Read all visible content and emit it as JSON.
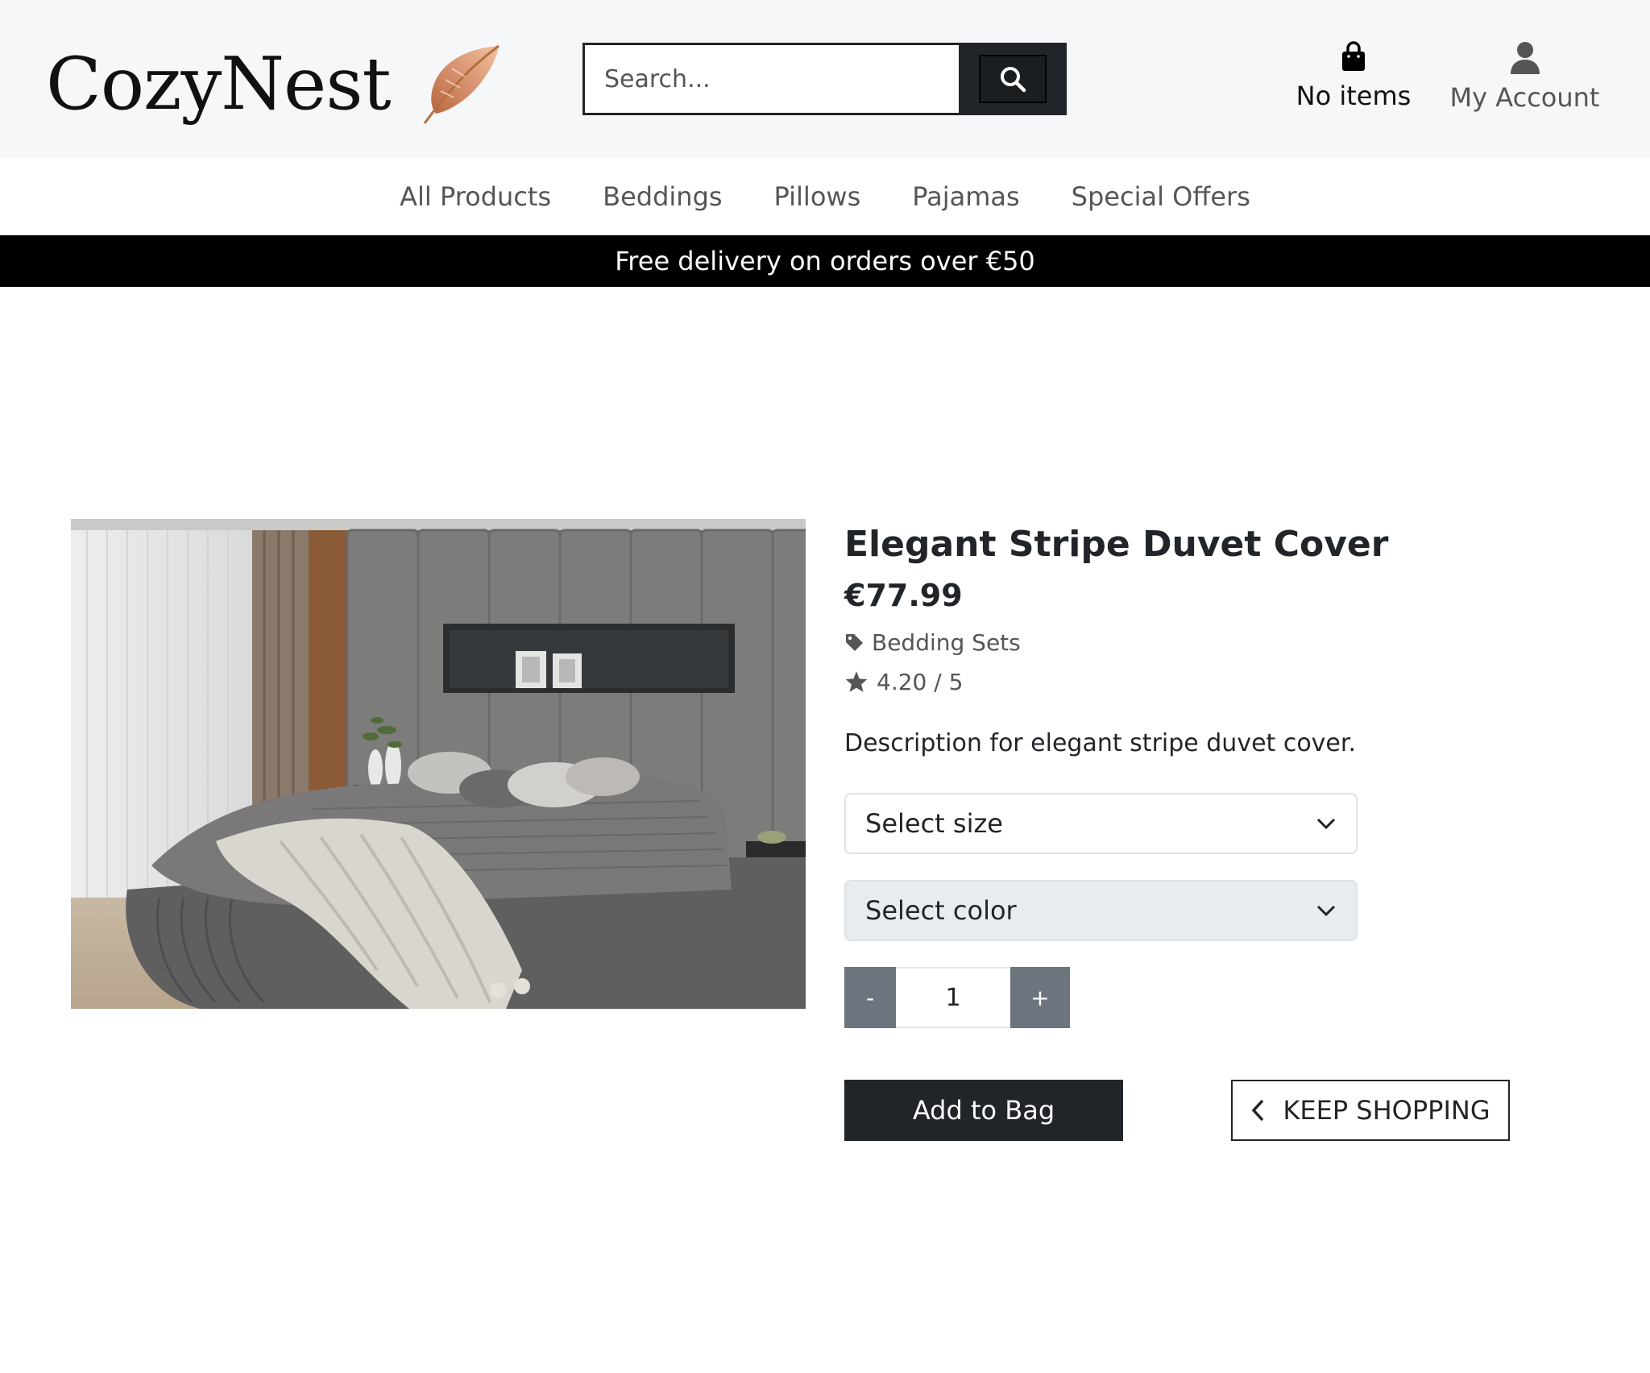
{
  "header": {
    "logo_text": "CozyNest",
    "search_placeholder": "Search...",
    "bag_label": "No items",
    "account_label": "My Account"
  },
  "nav": {
    "items": [
      "All Products",
      "Beddings",
      "Pillows",
      "Pajamas",
      "Special Offers"
    ]
  },
  "banner": {
    "text": "Free delivery on orders over €50"
  },
  "product": {
    "title": "Elegant Stripe Duvet Cover",
    "price": "€77.99",
    "category": "Bedding Sets",
    "rating": "4.20 / 5",
    "description": "Description for elegant stripe duvet cover.",
    "size_select": "Select size",
    "color_select": "Select color",
    "qty_minus": "-",
    "qty_value": "1",
    "qty_plus": "+",
    "add_button": "Add to Bag",
    "keep_button": "KEEP SHOPPING"
  },
  "icons": {
    "logo": "feather-icon",
    "search": "search-icon",
    "bag": "shopping-bag-icon",
    "account": "user-icon",
    "category": "tag-icon",
    "rating": "star-icon",
    "select": "chevron-down-icon",
    "back": "chevron-left-icon"
  },
  "colors": {
    "dark": "#212529",
    "muted": "#6c757d",
    "feather_light": "#e8b89a",
    "feather_dark": "#b8683e"
  }
}
